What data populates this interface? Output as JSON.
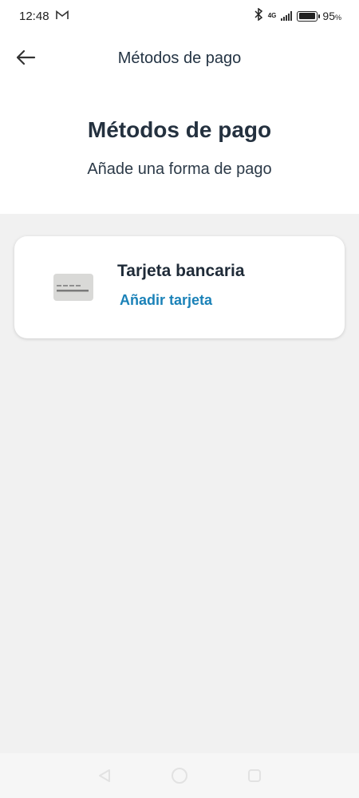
{
  "status_bar": {
    "time": "12:48",
    "network_top": "4G",
    "network_bottom": "4G",
    "battery_percent": "95",
    "battery_unit": "%",
    "battery_level": 0.95
  },
  "app_bar": {
    "title": "Métodos de pago",
    "back_icon": "arrow-left-icon"
  },
  "header": {
    "title": "Métodos de pago",
    "subtitle": "Añade una forma de pago"
  },
  "payment_methods": [
    {
      "title": "Tarjeta bancaria",
      "action": "Añadir tarjeta",
      "icon": "credit-card-icon"
    }
  ],
  "colors": {
    "link": "#1b82b8",
    "heading": "#24313f",
    "background": "#f1f1f1"
  },
  "nav_bar": {
    "back": "triangle-back-icon",
    "home": "circle-home-icon",
    "recents": "square-recents-icon"
  }
}
